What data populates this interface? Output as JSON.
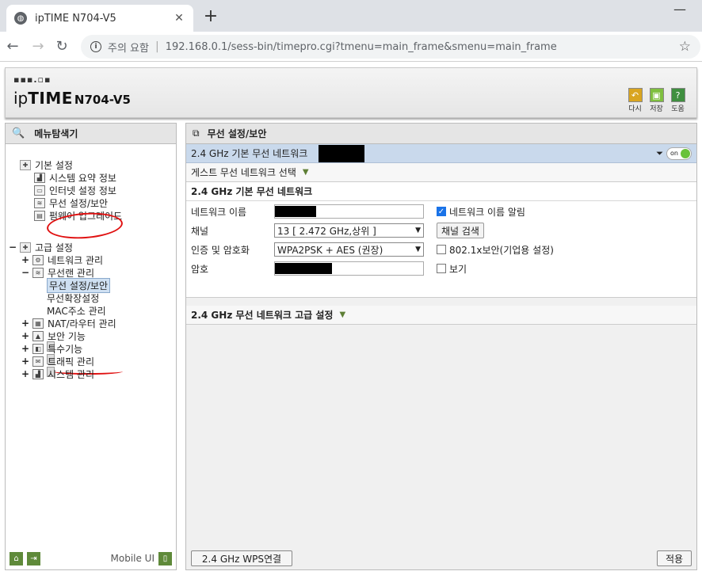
{
  "browser": {
    "tab_title": "ipTIME N704-V5",
    "tab_close": "✕",
    "new_tab": "+",
    "minimize": "—",
    "back": "←",
    "forward": "→",
    "refresh": "↻",
    "info": "i",
    "warning": "주의 요함",
    "separator": "|",
    "url": "192.168.0.1/sess-bin/timepro.cgi?tmenu=main_frame&smenu=main_frame",
    "star": "☆"
  },
  "header": {
    "logo_dots": "▪▪▪.▫▪",
    "logo_ip": "ip",
    "logo_time": "TIME",
    "logo_model": "N704-V5",
    "buttons": [
      {
        "icon": "↶",
        "label": "다시",
        "color": "#d9a520"
      },
      {
        "icon": "▣",
        "label": "저장",
        "color": "#7fbf3f"
      },
      {
        "icon": "?",
        "label": "도움",
        "color": "#3f8f3f"
      }
    ]
  },
  "sidebar": {
    "title": "메뉴탐색기",
    "search_icon": "🔍",
    "basic": {
      "label": "기본 설정",
      "items": [
        "시스템 요약 정보",
        "인터넷 설정 정보",
        "무선 설정/보안",
        "펌웨어 업그레이드"
      ]
    },
    "advanced": {
      "label": "고급 설정",
      "items": {
        "network": "네트워크 관리",
        "wireless": "무선랜 관리",
        "wireless_sub": [
          "무선 설정/보안",
          "무선확장설정",
          "MAC주소 관리"
        ],
        "nat": "NAT/라우터 관리",
        "security": "보안 기능",
        "special": "특수기능",
        "traffic": "트래픽 관리",
        "system": "시스템 관리"
      }
    },
    "expand_minus": "−",
    "expand_plus": "+",
    "mobile_ui": "Mobile UI"
  },
  "main": {
    "title": "무선 설정/보안",
    "net_bar_label": "2.4 GHz 기본 무선 네트워크",
    "toggle_label": "on",
    "guest_label": "게스트 무선 네트워크 선택",
    "section_basic": "2.4 GHz 기본 무선 네트워크",
    "fields": {
      "network_name_label": "네트워크 이름",
      "broadcast_label": "네트워크 이름 알림",
      "channel_label": "채널",
      "channel_value": "13 [ 2.472 GHz,상위 ]",
      "channel_search": "채널 검색",
      "auth_label": "인증 및 암호화",
      "auth_value": "WPA2PSK + AES (권장)",
      "enterprise_label": "802.1x보안(기업용 설정)",
      "password_label": "암호",
      "show_label": "보기"
    },
    "section_advanced": "2.4 GHz 무선 네트워크 고급 설정",
    "wps_button": "2.4 GHz WPS연결",
    "apply_button": "적용"
  }
}
